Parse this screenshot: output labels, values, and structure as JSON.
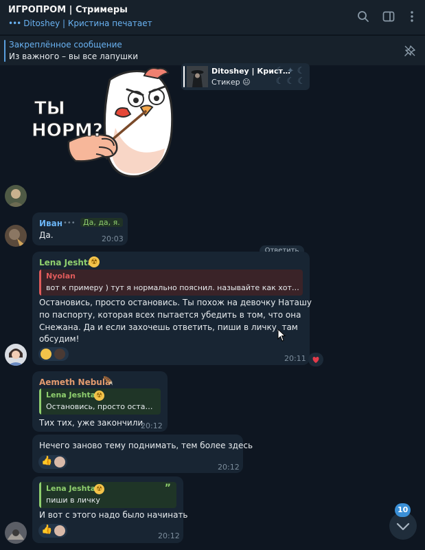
{
  "header": {
    "title": "ИГРОПРОМ | Стримеры",
    "typing_dots": "•••",
    "typing_status": "Ditoshey | Кристина печатает"
  },
  "pinned": {
    "title": "Закреплённое сообщение",
    "text": "Из важного – вы все лапушки"
  },
  "reply_card": {
    "name": "Ditoshey | Крист…",
    "sub": "Стикер 😐"
  },
  "sticker": {
    "line1": "ТЫ",
    "line2": "НОРМ?"
  },
  "reply_action": "Ответить",
  "messages": [
    {
      "sender": "Иван",
      "sender_tag": "Да, да, я.",
      "text": "Да.",
      "time": "20:03"
    },
    {
      "sender": "Lena Jeshta",
      "quote_name": "Nyolan",
      "quote_text": "вот к примеру ) тут я нормально пояснил. называйте как хот…",
      "lines": [
        "Остановись, просто остановись. Ты похож на девочку Наташу",
        "по паспорту, которая всех пытается убедить в том, что она",
        "Снежана. Да и если захочешь ответить, пиши в личку, там",
        "обсудим!"
      ],
      "time": "20:11"
    },
    {
      "sender": "Aemeth Nebula",
      "quote_name": "Lena Jeshta",
      "quote_text": "Остановись, просто оста…",
      "text": "Тих тих, уже закончили",
      "time": "20:12"
    },
    {
      "text": "Нечего заново тему поднимать, тем более здесь",
      "time": "20:12"
    },
    {
      "quote_name": "Lena Jeshta",
      "quote_text": "пиши в личку",
      "text": "И вот с этого надо было начинать",
      "time": "20:12"
    }
  ],
  "unread_count": "10",
  "colors": {
    "background": "#0e1621",
    "bubble": "#182533",
    "accent": "#6ab3f3",
    "lena": "#8fcf6e",
    "ivan": "#6ab3f3",
    "aemeth": "#e39b6f",
    "nyolan": "#e05b5b"
  }
}
